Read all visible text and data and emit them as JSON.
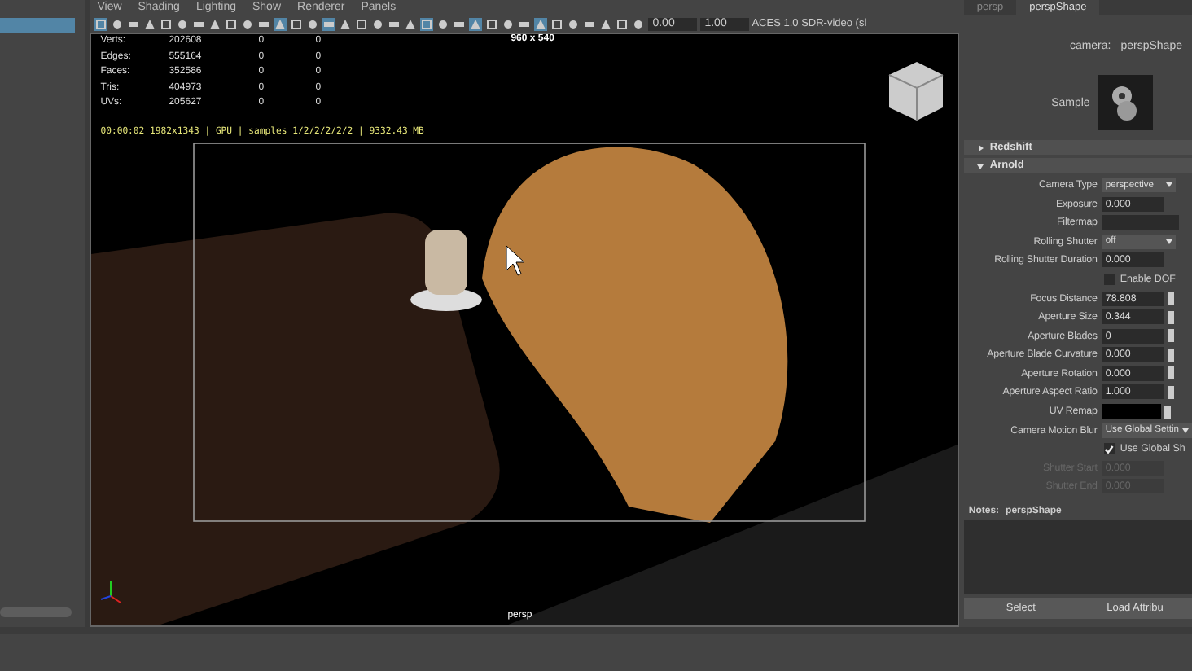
{
  "menu": [
    "View",
    "Shading",
    "Lighting",
    "Show",
    "Renderer",
    "Panels"
  ],
  "toolbar": {
    "tools": [
      {
        "selected": true
      },
      {
        "selected": false
      },
      {
        "selected": false
      },
      {
        "selected": false
      },
      {
        "selected": false
      },
      {
        "selected": false
      },
      {
        "selected": false
      },
      {
        "selected": false
      },
      {
        "selected": false
      },
      {
        "selected": false
      },
      {
        "selected": false
      },
      {
        "selected": true
      },
      {
        "selected": false
      },
      {
        "selected": false
      },
      {
        "selected": true
      },
      {
        "selected": false
      },
      {
        "selected": false
      },
      {
        "selected": false
      },
      {
        "selected": false
      },
      {
        "selected": false
      },
      {
        "selected": true
      },
      {
        "selected": false
      },
      {
        "selected": false
      },
      {
        "selected": true
      },
      {
        "selected": false
      },
      {
        "selected": false
      },
      {
        "selected": false
      },
      {
        "selected": true
      },
      {
        "selected": false
      },
      {
        "selected": false
      },
      {
        "selected": false
      },
      {
        "selected": false
      },
      {
        "selected": false
      },
      {
        "selected": false
      }
    ],
    "exposure": "0.00",
    "gamma": "1.00",
    "view_transform": "ACES 1.0 SDR-video (sl"
  },
  "viewport": {
    "resolution": "960 x 540",
    "camera": "persp",
    "stats": [
      {
        "label": "Verts:",
        "values": [
          "202608",
          "0",
          "0"
        ]
      },
      {
        "label": "Edges:",
        "values": [
          "555164",
          "0",
          "0"
        ]
      },
      {
        "label": "Faces:",
        "values": [
          "352586",
          "0",
          "0"
        ]
      },
      {
        "label": "Tris:",
        "values": [
          "404973",
          "0",
          "0"
        ]
      },
      {
        "label": "UVs:",
        "values": [
          "205627",
          "0",
          "0"
        ]
      }
    ],
    "render_info": "00:00:02 1982x1343 | GPU | samples 1/2/2/2/2/2 | 9332.43 MB"
  },
  "attribute_editor": {
    "tabs": [
      {
        "label": "persp",
        "selected": false
      },
      {
        "label": "perspShape",
        "selected": true
      }
    ],
    "camera_label": "camera:",
    "camera": "perspShape",
    "sample_label": "Sample",
    "sections": [
      {
        "title": "Redshift",
        "expanded": false
      },
      {
        "title": "Arnold",
        "expanded": true
      }
    ],
    "attributes": [
      {
        "kind": "dropdown",
        "label": "Camera Type",
        "value": "perspective",
        "disabled": false
      },
      {
        "kind": "field",
        "label": "Exposure",
        "value": "0.000",
        "disabled": false
      },
      {
        "kind": "wide",
        "label": "Filtermap",
        "disabled": false
      },
      {
        "kind": "dropdown",
        "label": "Rolling Shutter",
        "value": "off",
        "disabled": false
      },
      {
        "kind": "field",
        "label": "Rolling Shutter Duration",
        "value": "0.000",
        "disabled": false
      },
      {
        "kind": "checkbox",
        "label": "Enable DOF",
        "checked": false,
        "disabled": false
      },
      {
        "kind": "slider",
        "label": "Focus Distance",
        "value": "78.808",
        "disabled": false
      },
      {
        "kind": "slider",
        "label": "Aperture Size",
        "value": "0.344",
        "disabled": false
      },
      {
        "kind": "slider",
        "label": "Aperture Blades",
        "value": "0",
        "disabled": false
      },
      {
        "kind": "slider",
        "label": "Aperture Blade Curvature",
        "value": "0.000",
        "disabled": false
      },
      {
        "kind": "slider",
        "label": "Aperture Rotation",
        "value": "0.000",
        "disabled": false
      },
      {
        "kind": "slider",
        "label": "Aperture Aspect Ratio",
        "value": "1.000",
        "disabled": false
      },
      {
        "kind": "color",
        "label": "UV Remap",
        "color": "#000000",
        "disabled": false
      },
      {
        "kind": "dropdown",
        "label": "Camera Motion Blur",
        "value": "Use Global Settin",
        "disabled": false
      },
      {
        "kind": "checkbox",
        "label": "Use Global Sh",
        "checked": true,
        "disabled": false
      },
      {
        "kind": "field",
        "label": "Shutter Start",
        "value": "0.000",
        "disabled": true
      },
      {
        "kind": "field",
        "label": "Shutter End",
        "value": "0.000",
        "disabled": true
      }
    ],
    "notes_label": "Notes:",
    "notes_title": "perspShape",
    "buttons": [
      "Select",
      "Load Attribu"
    ]
  }
}
